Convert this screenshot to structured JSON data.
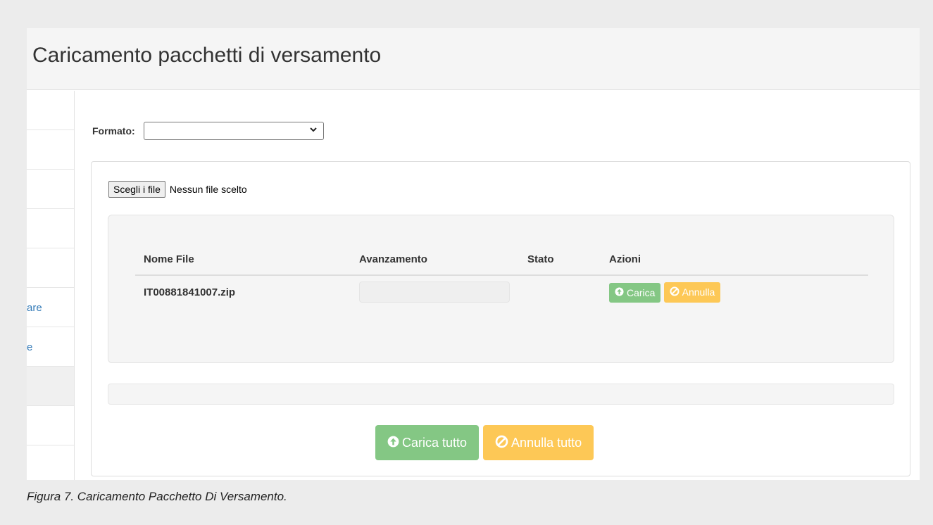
{
  "header": {
    "title": "Caricamento pacchetti di versamento"
  },
  "sidebar": {
    "items": [
      {
        "label": ""
      },
      {
        "label": ""
      },
      {
        "label": ""
      },
      {
        "label": ""
      },
      {
        "label": ""
      },
      {
        "label": "are"
      },
      {
        "label": "e"
      },
      {
        "label": "",
        "active": true
      },
      {
        "label": ""
      },
      {
        "label": ""
      }
    ]
  },
  "form": {
    "formato_label": "Formato:",
    "formato_value": ""
  },
  "file_input": {
    "button_label": "Scegli i file",
    "status": "Nessun file scelto"
  },
  "table": {
    "headers": [
      "Nome File",
      "Avanzamento",
      "Stato",
      "Azioni"
    ],
    "rows": [
      {
        "nome_file": "IT00881841007.zip",
        "avanzamento": 0,
        "stato": "",
        "carica_label": "Carica",
        "annulla_label": "Annulla"
      }
    ]
  },
  "global_progress": 0,
  "actions": {
    "carica_tutto": "Carica tutto",
    "annulla_tutto": "Annulla tutto"
  },
  "caption": "Figura 7. Caricamento Pacchetto Di Versamento.",
  "colors": {
    "success": "#84c784",
    "warning": "#fdc856",
    "link": "#337ab7"
  },
  "icons": {
    "upload": "circle-arrow-up-icon",
    "cancel": "ban-icon",
    "select": "chevron-down-icon"
  }
}
